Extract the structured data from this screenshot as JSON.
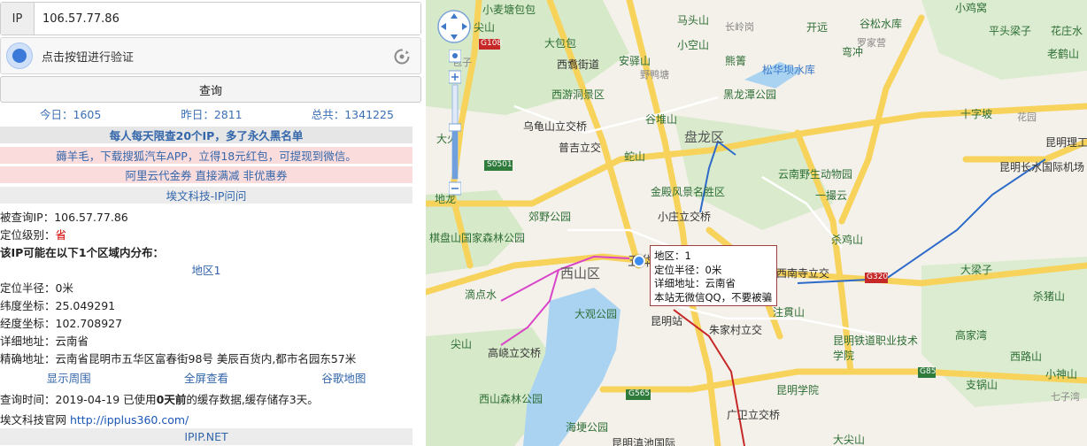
{
  "form": {
    "ip_prefix": "IP",
    "ip_value": "106.57.77.86",
    "captcha_text": "点击按钮进行验证",
    "query_label": "查询"
  },
  "stats": {
    "today": "今日：1605",
    "yesterday": "昨日：2811",
    "total": "总共：1341225"
  },
  "banners": {
    "limit": "每人每天限查20个IP，多了永久黑名单",
    "ad1": "薅羊毛，下载搜狐汽车APP，立得18元红包，可提现到微信。",
    "ad2": "阿里云代金券 直接满减 非优惠券",
    "source1": "埃文科技-IP问问",
    "source2": "IPIP.NET"
  },
  "result": {
    "queried_ip": "被查询IP：106.57.77.86",
    "level_label": "定位级别：",
    "level_value": "省",
    "distribution": "该IP可能在以下1个区域内分布：",
    "area_title": "地区1",
    "radius": "定位半径：0米",
    "latitude": "纬度坐标：25.049291",
    "longitude": "经度坐标：102.708927",
    "detail": "详细地址：云南省",
    "precise": "精确地址：云南省昆明市五华区富春街98号 美辰百货内,都市名园东57米",
    "link_around": "显示周围",
    "link_full": "全屏查看",
    "link_google": "谷歌地图",
    "query_time_a": "查询时间：2019-04-19 已使用",
    "query_time_b": "0天前",
    "query_time_c": "的缓存数据,缓存储存3天。",
    "site_label": "埃文科技官网 ",
    "site_url": "http://ipplus360.com/"
  },
  "popup": {
    "line1": "地区：1",
    "line2": "定位半径：0米",
    "line3": "详细地址：云南省",
    "line4": "本站无微信QQ，不要被骗"
  },
  "map_labels": {
    "xiaomaitang": "小麦塘包包",
    "jianshan": "尖山",
    "dabaobao": "大包包",
    "xizheng": "西翥街道",
    "majian": "马头山",
    "xiaokongshan": "小空山",
    "changling": "长岭岗",
    "kaiyuan": "开远",
    "baozi": "包子",
    "luojie": "罗家营",
    "gusongshuiku": "谷松水库",
    "xiaojiyi": "小鸡窝",
    "pingshuliangzi": "平头梁子",
    "huazhuo": "花庄水",
    "laohe": "老鹤山",
    "anjia": "安驿山",
    "yeyatang": "野鸭塘",
    "xiongpo": "熊箐",
    "songhuaba": "松华坝水库",
    "wanchong": "弯冲",
    "xiyoudong": "西游洞景区",
    "heilongtan": "黑龙潭公园",
    "wuguishan": "乌龟山立交桥",
    "guduishan": "谷堆山",
    "shizipo": "十字坡",
    "dahuo": "大火",
    "puji": "普吉立交",
    "shedashan": "蛇山",
    "panlong": "盘龙区",
    "yunnanyesheng": "云南野生动物园",
    "kunminglg": "昆明理工大学",
    "changshui": "昆明长水国际机场",
    "huayuan": "花园",
    "jinxishan": "金殿风景名胜区",
    "yipiyun": "一撮云",
    "zhaoyangshan": "棋盘山国家森林公园",
    "jiaoye": "郊野公园",
    "xiaozhuang": "小庄立交桥",
    "shaji": "杀鸡山",
    "dilong": "地龙",
    "xishan": "西山区",
    "wuhua": "五华",
    "xishanlj": "西南寺立交",
    "daliang": "大梁子",
    "dishuishui": "滴点水",
    "daguan": "大观公园",
    "kunmingzhan": "昆明站",
    "zhuguan": "注貫山",
    "shazhu": "杀猪山",
    "gaoqiao": "高峣立交桥",
    "zhujiacun": "朱家村立交",
    "kunmingtielu": "昆明铁道职业技术学院",
    "gaojiawan": "高家湾",
    "xishanslgy": "西山森林公园",
    "kunmingxy": "昆明学院",
    "xilushan": "西路山",
    "zhiqiangshan": "支锅山",
    "xiaoshen": "小神山",
    "haigeng": "海埂公园",
    "guangwei": "广卫立交桥",
    "dianchi": "昆明滇池国际",
    "daishan": "大尖山",
    "jianshan2": "尖山",
    "qizhen": "七子湾",
    "road_g108": "G108",
    "road_s0501": "S0501",
    "road_g320": "G320",
    "road_g565": "G565",
    "road_g85": "G85"
  },
  "colors": {
    "map_bg": "#f4f1ea",
    "road_yellow": "#f7d35b",
    "road_white": "#ffffff",
    "water": "#a9d3f1",
    "green": "#cde6c1",
    "link_blue": "#3366aa",
    "banner_pink": "#fbdcdc",
    "marker_blue": "#3d8df0"
  }
}
